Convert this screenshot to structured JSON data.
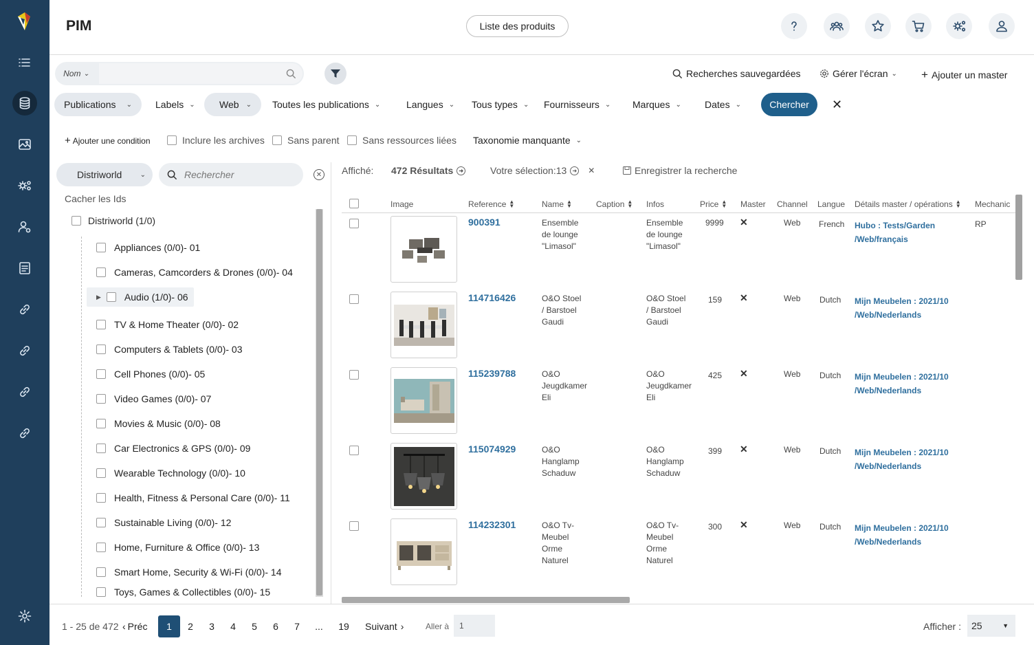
{
  "app": {
    "title": "PIM",
    "list_button": "Liste des produits"
  },
  "rail": {
    "items": [
      "logo",
      "list-icon",
      "database-icon",
      "image-icon",
      "settings-network-icon",
      "user-settings-icon",
      "document-icon",
      "link-icon",
      "link-icon",
      "link-icon",
      "link-icon",
      "gear-icon"
    ]
  },
  "header_icons": [
    "help-icon",
    "team-icon",
    "star-icon",
    "cart-icon",
    "workflow-settings-icon",
    "user-icon"
  ],
  "search": {
    "field": "Nom",
    "placeholder": ""
  },
  "toplinks": {
    "saved": "Recherches sauvegardées",
    "manage": "Gérer l'écran",
    "add_master": "Ajouter un master"
  },
  "filters": [
    "Publications",
    "Labels",
    "Web",
    "Toutes les publications",
    "Langues",
    "Tous types",
    "Fournisseurs",
    "Marques",
    "Dates"
  ],
  "search_button": "Chercher",
  "conditions": {
    "add": "Ajouter une condition",
    "include_archives": "Inclure les archives",
    "no_parent": "Sans parent",
    "no_resources": "Sans ressources liées",
    "missing_taxonomy": "Taxonomie manquante"
  },
  "tree": {
    "catalog": "Distriworld",
    "search_placeholder": "Rechercher",
    "hide_ids": "Cacher les Ids",
    "root": "Distriworld (1/0)",
    "items": [
      "Appliances (0/0)- 01",
      "Cameras, Camcorders & Drones (0/0)- 04",
      "Audio (1/0)- 06",
      "TV & Home Theater (0/0)- 02",
      "Computers & Tablets (0/0)- 03",
      "Cell Phones (0/0)- 05",
      "Video Games (0/0)- 07",
      "Movies & Music (0/0)- 08",
      "Car Electronics & GPS (0/0)- 09",
      "Wearable Technology (0/0)- 10",
      "Health, Fitness & Personal Care (0/0)- 11",
      "Sustainable Living (0/0)- 12",
      "Home, Furniture & Office (0/0)- 13",
      "Smart Home, Security & Wi-Fi (0/0)- 14",
      "Toys, Games & Collectibles (0/0)- 15"
    ]
  },
  "results": {
    "shown_label": "Affiché:",
    "count": "472 Résultats",
    "selection": "Votre sélection:13",
    "save": "Enregistrer la recherche"
  },
  "table": {
    "columns": [
      "Image",
      "Reference",
      "Name",
      "Caption",
      "Infos",
      "Price",
      "Master",
      "Channel",
      "Langue",
      "Détails master / opérations",
      "Mechanic"
    ],
    "rows": [
      {
        "ref": "900391",
        "name": [
          "Ensemble",
          "de lounge",
          "\"Limasol\""
        ],
        "infos": [
          "Ensemble",
          "de lounge",
          "\"Limasol\""
        ],
        "price": "9999",
        "master": "✕",
        "channel": "Web",
        "langue": "French",
        "details": [
          "Hubo : Tests/Garden",
          "/Web/français"
        ],
        "mechanic": "RP"
      },
      {
        "ref": "114716426",
        "name": [
          "O&O Stoel",
          "/ Barstoel",
          "Gaudi"
        ],
        "infos": [
          "O&O Stoel",
          "/ Barstoel",
          "Gaudi"
        ],
        "price": "159",
        "master": "✕",
        "channel": "Web",
        "langue": "Dutch",
        "details": [
          "Mijn Meubelen : 2021/10",
          "/Web/Nederlands"
        ],
        "mechanic": ""
      },
      {
        "ref": "115239788",
        "name": [
          "O&O",
          "Jeugdkamer",
          "Eli"
        ],
        "infos": [
          "O&O",
          "Jeugdkamer",
          "Eli"
        ],
        "price": "425",
        "master": "✕",
        "channel": "Web",
        "langue": "Dutch",
        "details": [
          "Mijn Meubelen : 2021/10",
          "/Web/Nederlands"
        ],
        "mechanic": ""
      },
      {
        "ref": "115074929",
        "name": [
          "O&O",
          "Hanglamp",
          "Schaduw"
        ],
        "infos": [
          "O&O",
          "Hanglamp",
          "Schaduw"
        ],
        "price": "399",
        "master": "✕",
        "channel": "Web",
        "langue": "Dutch",
        "details": [
          "Mijn Meubelen : 2021/10",
          "/Web/Nederlands"
        ],
        "mechanic": ""
      },
      {
        "ref": "114232301",
        "name": [
          "O&O Tv-",
          "Meubel",
          "Orme",
          "Naturel"
        ],
        "infos": [
          "O&O Tv-",
          "Meubel",
          "Orme",
          "Naturel"
        ],
        "price": "300",
        "master": "✕",
        "channel": "Web",
        "langue": "Dutch",
        "details": [
          "Mijn Meubelen : 2021/10",
          "/Web/Nederlands"
        ],
        "mechanic": ""
      }
    ]
  },
  "footer": {
    "range": "1 - 25 de 472",
    "prev": "Préc",
    "pages": [
      "1",
      "2",
      "3",
      "4",
      "5",
      "6",
      "7",
      "...",
      "19"
    ],
    "next": "Suivant",
    "goto_label": "Aller à",
    "goto_value": "1",
    "per_page_label": "Afficher :",
    "per_page": "25"
  },
  "colors": {
    "rail": "#1f3f5c",
    "accent": "#1f5f8b",
    "link": "#2f6f9e"
  }
}
